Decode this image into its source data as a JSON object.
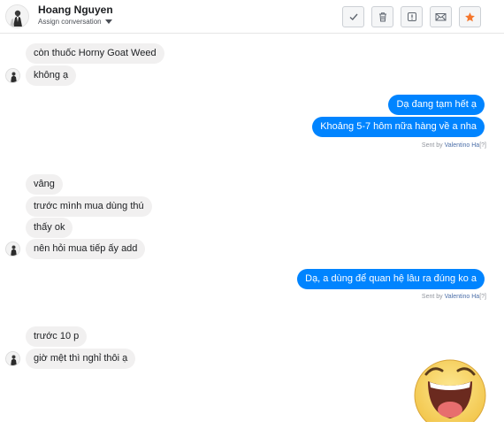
{
  "header": {
    "contact_name": "Hoang Nguyen",
    "assign_label": "Assign conversation"
  },
  "toolbar": {
    "done_icon": "check-icon",
    "delete_icon": "trash-icon",
    "spam_icon": "alert-icon",
    "unread_icon": "envelope-icon",
    "star_icon": "star-icon",
    "star_color": "#f5762b"
  },
  "messages": {
    "m1": "còn thuốc Horny Goat Weed",
    "m2": "không ạ",
    "m3": "Dạ đang tạm hết ạ",
    "m4": "Khoảng 5-7 hôm nữa hàng về a nha",
    "m5": "vâng",
    "m6": "trước mình mua dùng thú",
    "m7": "thấy ok",
    "m8": "nên hỏi mua tiếp ấy add",
    "m9": "Dạ, a dùng để quan hệ lâu ra đúng ko a",
    "m10": "trước 10 p",
    "m11": "giờ mệt thì nghỉ thôi ạ"
  },
  "sent_by": {
    "prefix": "Sent by",
    "agent": "Valentino Ha",
    "suffix": "[?]"
  },
  "colors": {
    "outgoing": "#0084ff",
    "incoming": "#f1f0f0"
  }
}
